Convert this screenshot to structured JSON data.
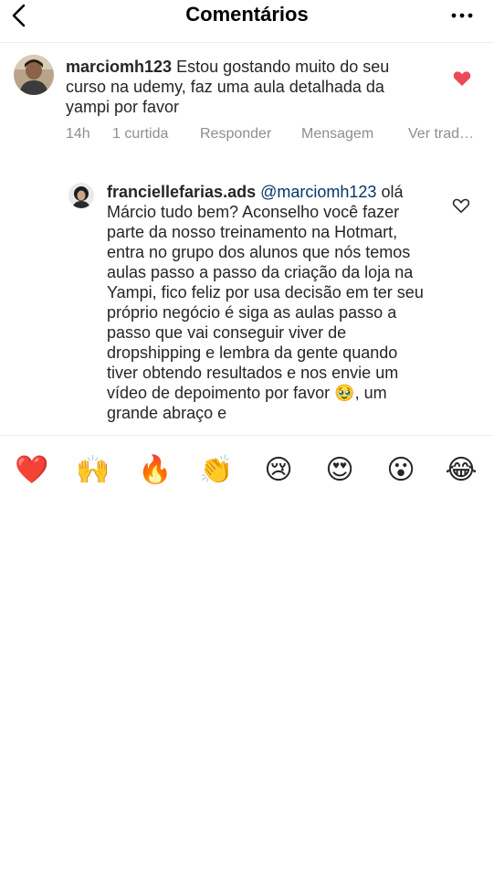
{
  "header": {
    "title": "Comentários"
  },
  "comment": {
    "username": "marciomh123",
    "text": "Estou gostando muito do seu curso na udemy, faz uma aula detalhada da yampi por favor",
    "time": "14h",
    "likes": "1 curtida",
    "reply_label": "Responder",
    "message_label": "Mensagem",
    "translate_label": "Ver trad…",
    "liked": true
  },
  "reply": {
    "username": "franciellefarias.ads",
    "mention": "@marciomh123",
    "text": "olá Márcio tudo bem? Aconselho você fazer parte da nosso treinamento na Hotmart, entra no grupo dos alunos que nós temos aulas passo a passo da criação da loja na Yampi, fico feliz por usa decisão em ter seu próprio negócio é siga as aulas passo a passo que vai conseguir viver de dropshipping e lembra da gente quando tiver obtendo resultados e nos envie um vídeo de depoimento por favor 🥹, um grande abraço e",
    "liked": false
  },
  "emoji_bar": {
    "emojis": [
      "❤️",
      "🙌",
      "🔥",
      "👏",
      "😢",
      "😍",
      "😮",
      "😂"
    ]
  },
  "colors": {
    "like_red": "#ed4956",
    "meta_gray": "#8e8e8e",
    "mention_blue": "#00376b"
  }
}
